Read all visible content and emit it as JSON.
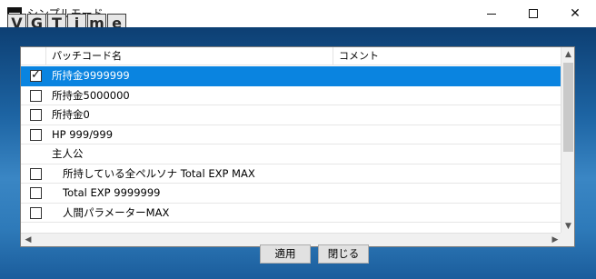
{
  "window": {
    "title": "シンプルモード",
    "watermark": [
      "V",
      "G",
      "T",
      "i",
      "m",
      "e"
    ],
    "controls": {
      "minimize": "—",
      "maximize": "☐",
      "close": "✕"
    }
  },
  "list": {
    "columns": [
      "パッチコード名",
      "コメント"
    ],
    "rows": [
      {
        "label": "所持金9999999",
        "checked": true,
        "selected": true,
        "has_checkbox": true,
        "indent": false
      },
      {
        "label": "所持金5000000",
        "checked": false,
        "selected": false,
        "has_checkbox": true,
        "indent": false
      },
      {
        "label": "所持金0",
        "checked": false,
        "selected": false,
        "has_checkbox": true,
        "indent": false
      },
      {
        "label": "HP 999/999",
        "checked": false,
        "selected": false,
        "has_checkbox": true,
        "indent": false
      },
      {
        "label": "主人公",
        "checked": false,
        "selected": false,
        "has_checkbox": false,
        "indent": false
      },
      {
        "label": "所持している全ペルソナ Total EXP MAX",
        "checked": false,
        "selected": false,
        "has_checkbox": true,
        "indent": true
      },
      {
        "label": "Total EXP 9999999",
        "checked": false,
        "selected": false,
        "has_checkbox": true,
        "indent": true
      },
      {
        "label": "人間パラメーターMAX",
        "checked": false,
        "selected": false,
        "has_checkbox": true,
        "indent": true
      }
    ]
  },
  "buttons": {
    "apply": "適用",
    "close": "閉じる"
  },
  "colors": {
    "selection": "#0a84e0",
    "client_top": "#0d3f73",
    "client_mid": "#3a86c4"
  }
}
